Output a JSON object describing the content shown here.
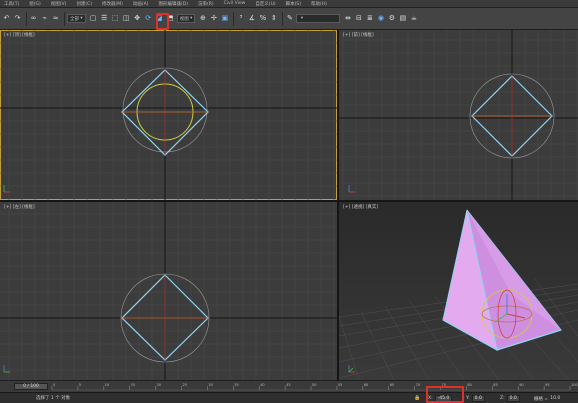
{
  "menu": [
    "工具(T)",
    "组(G)",
    "视图(V)",
    "创建(C)",
    "修改器(M)",
    "动画(A)",
    "图形编辑器(D)",
    "渲染(R)",
    "Civil View",
    "自定义(U)",
    "脚本(S)",
    "帮助(H)"
  ],
  "toolbar": {
    "undo_icon": "undo-icon",
    "selection_filter": "全部",
    "reference_coord": "视图",
    "named_selection": "",
    "highlight_color": "#e0302a",
    "icon_accent": "#6fb2ff"
  },
  "viewports": {
    "top": "[+] [顶] [线框]",
    "front": "[+] [前] [线框]",
    "left": "[+] [左] [线框]",
    "perspective": "[+] [透视] [真实]",
    "colors": {
      "background": "#3c3c3c",
      "grid": "#4a4a4a",
      "axis": "#151515",
      "object_wire": "#8fd4f2",
      "sphere_wire": "#d0cf3a",
      "pyramid_fill": "#e4aaf0",
      "active_border": "#c7a033"
    }
  },
  "timeline": {
    "frame_counter": "0 / 100",
    "ticks": [
      "0",
      "5",
      "10",
      "15",
      "20",
      "25",
      "30",
      "35",
      "40",
      "45",
      "50",
      "55",
      "60",
      "65",
      "70",
      "75",
      "80",
      "85",
      "90",
      "95",
      "100"
    ]
  },
  "status": {
    "selection_text": "选择了 1 个 对象",
    "x_label": "X:",
    "x_value": "-45.0",
    "y_label": "Y:",
    "y_value": "0.0",
    "z_label": "Z:",
    "z_value": "0.0",
    "grid_label": "栅格 =",
    "grid_value": "10.0"
  }
}
